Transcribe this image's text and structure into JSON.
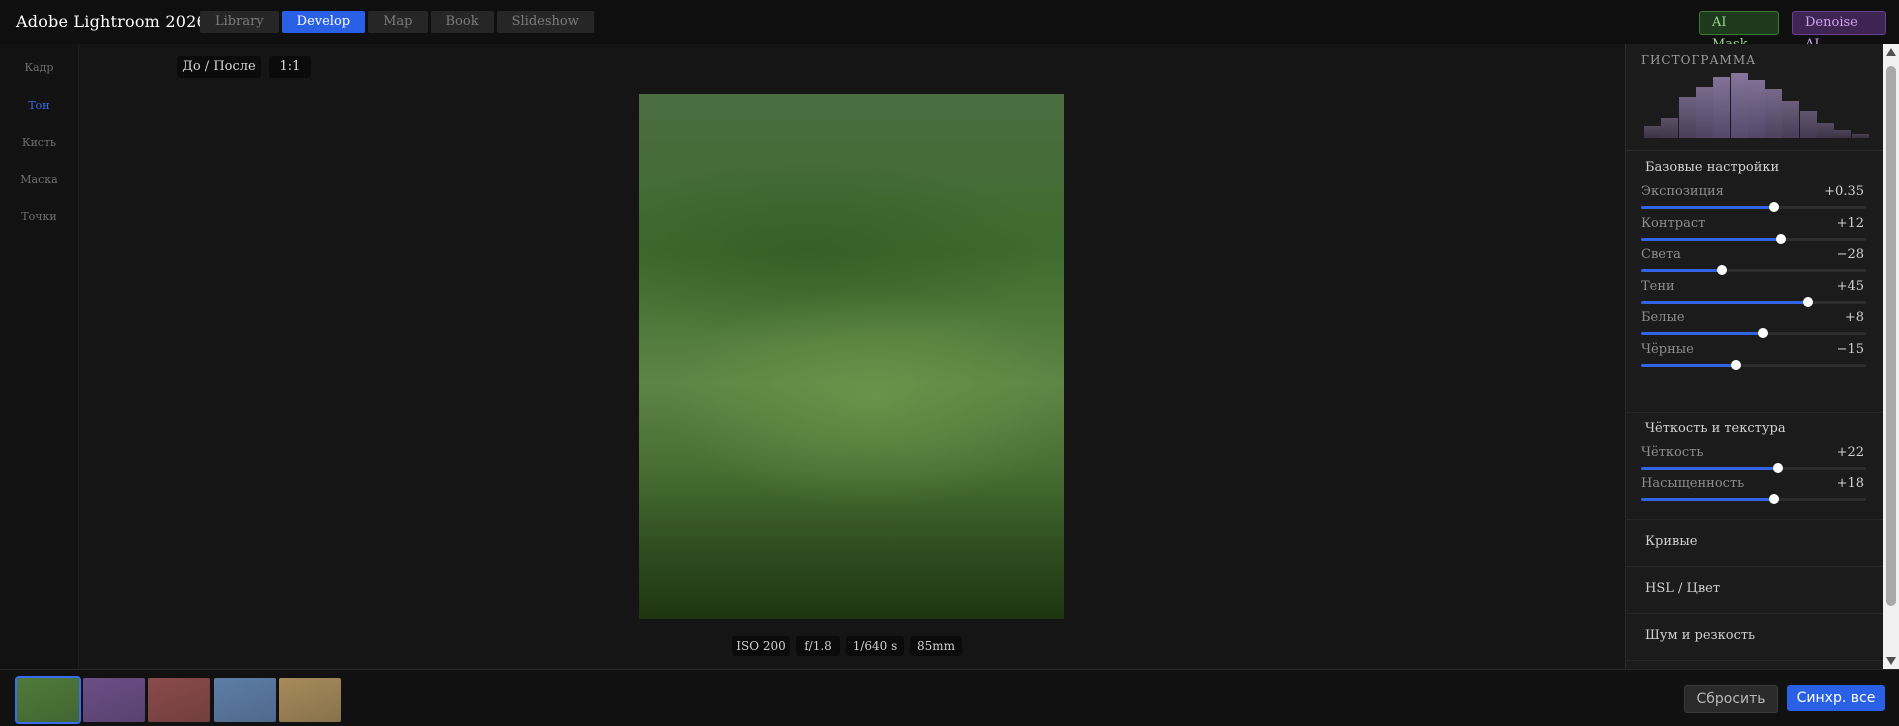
{
  "app": {
    "title": "Adobe Lightroom 2026"
  },
  "tabs": [
    {
      "label": "Library",
      "active": false
    },
    {
      "label": "Develop",
      "active": true
    },
    {
      "label": "Map",
      "active": false
    },
    {
      "label": "Book",
      "active": false
    },
    {
      "label": "Slideshow",
      "active": false
    }
  ],
  "top_buttons": {
    "ai_mask": "AI Mask",
    "denoise": "Denoise AI"
  },
  "left_tools": [
    {
      "label": "Кадр",
      "active": false
    },
    {
      "label": "Тон",
      "active": true
    },
    {
      "label": "Кисть",
      "active": false
    },
    {
      "label": "Маска",
      "active": false
    },
    {
      "label": "Точки",
      "active": false
    }
  ],
  "canvas": {
    "before_after": "До / После",
    "zoom": "1:1",
    "exif": {
      "iso": "ISO 200",
      "aperture": "f/1.8",
      "shutter": "1/640 s",
      "focal": "85mm"
    }
  },
  "panel": {
    "histogram_title": "ГИСТОГРАММА",
    "histogram_levels": [
      0.18,
      0.3,
      0.6,
      0.75,
      0.9,
      0.95,
      0.86,
      0.72,
      0.55,
      0.4,
      0.22,
      0.12,
      0.06
    ],
    "basic_title": "Базовые настройки",
    "basic_sliders": [
      {
        "label": "Экспозиция",
        "value": "+0.35",
        "level": 0.59
      },
      {
        "label": "Контраст",
        "value": "+12",
        "level": 0.62
      },
      {
        "label": "Света",
        "value": "−28",
        "level": 0.36
      },
      {
        "label": "Тени",
        "value": "+45",
        "level": 0.74
      },
      {
        "label": "Белые",
        "value": "+8",
        "level": 0.54
      },
      {
        "label": "Чёрные",
        "value": "−15",
        "level": 0.42
      }
    ],
    "clarity_title": "Чёткость и текстура",
    "clarity_sliders": [
      {
        "label": "Чёткость",
        "value": "+22",
        "level": 0.61
      },
      {
        "label": "Насыщенность",
        "value": "+18",
        "level": 0.59
      }
    ],
    "collapsed_sections": [
      "Кривые",
      "HSL / Цвет",
      "Шум и резкость"
    ]
  },
  "filmstrip": {
    "thumbnails": [
      {
        "color": "#4f7a3a",
        "selected": true
      },
      {
        "color": "#6a4e86",
        "selected": false
      },
      {
        "color": "#8a4a4a",
        "selected": false
      },
      {
        "color": "#5d7ea8",
        "selected": false
      },
      {
        "color": "#a68a5a",
        "selected": false
      }
    ],
    "reset_label": "Сбросить",
    "sync_label": "Синхр. все"
  },
  "colors": {
    "accent": "#2960e6"
  }
}
